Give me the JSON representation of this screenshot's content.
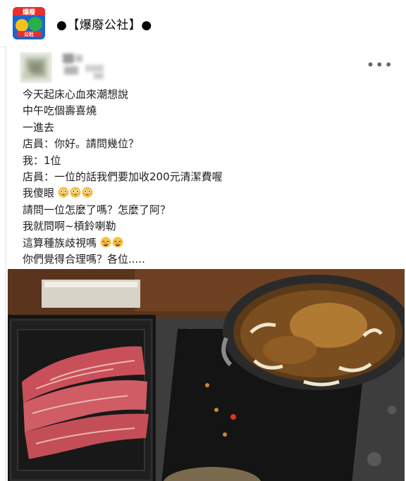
{
  "header": {
    "page_name": "●【爆廢公社】●",
    "logo_icon": "page-logo-icon"
  },
  "post": {
    "more_icon": "more-options-icon",
    "more_label": "•••",
    "lines": [
      "今天起床心血來潮想說",
      "中午吃個壽喜燒",
      "一進去",
      "店員：你好。請問幾位？",
      "我：1位",
      "店員：一位的話我們要加收200元清潔費喔",
      "我傻眼",
      "請問一位怎麼了嗎？怎麼了阿？",
      "我就問啊~槓鈴喇勒",
      "這算種族歧視嗎",
      "你們覺得合理嗎？各位....."
    ],
    "flushed_emoji_line": 6,
    "weary_emoji_line": 9,
    "photo_icon": "sukiyaki-photo"
  },
  "colors": {
    "text": "#1c1e21",
    "secondary": "#65676b",
    "border": "#dddfe2"
  }
}
